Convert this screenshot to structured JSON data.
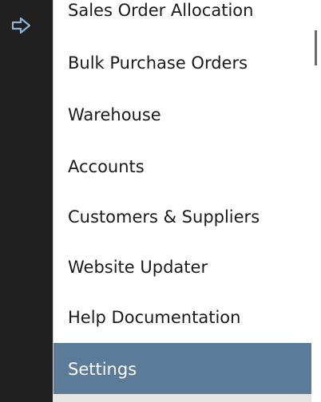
{
  "sidebar": {
    "toggle_icon": "arrow-right-icon",
    "background_color": "#202020"
  },
  "menu": {
    "items": [
      {
        "label": "Sales Order Allocation"
      },
      {
        "label": "Bulk Purchase Orders"
      },
      {
        "label": "Warehouse"
      },
      {
        "label": "Accounts"
      },
      {
        "label": "Customers & Suppliers"
      },
      {
        "label": "Website Updater"
      },
      {
        "label": "Help Documentation"
      },
      {
        "label": "Settings",
        "selected": true
      }
    ],
    "selected_color": "#5b7b98"
  }
}
